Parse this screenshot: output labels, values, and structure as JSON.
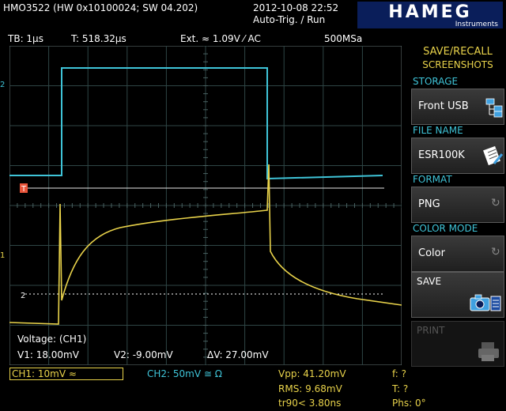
{
  "header": {
    "title": "HMO3522 (HW 0x10100024; SW 04.202)",
    "datetime": "2012-10-08 22:52",
    "trig_mode": "Auto-Trig. / Run",
    "logo_text": "HAMEG",
    "logo_sub": "Instruments"
  },
  "status": {
    "timebase": "TB: 1µs",
    "time": "T: 518.32µs",
    "trigger": "Ext. ≈ 1.09V ⁄ AC",
    "samplerate": "500MSa"
  },
  "screen": {
    "cursor_label": "Voltage: (CH1)",
    "v1": "V1: 18.00mV",
    "v2": "V2: -9.00mV",
    "dv": "ΔV: 27.00mV",
    "marker_ch1": "1",
    "marker_ch2": "2",
    "marker_cursor": "2"
  },
  "menu": {
    "title_line1": "SAVE/RECALL",
    "title_line2": "SCREENSHOTS",
    "storage_label": "STORAGE",
    "storage_value": "Front USB",
    "filename_label": "FILE NAME",
    "filename_value": "ESR100K",
    "format_label": "FORMAT",
    "format_value": "PNG",
    "colormode_label": "COLOR MODE",
    "colormode_value": "Color",
    "save_label": "SAVE",
    "print_label": "PRINT"
  },
  "footer": {
    "ch1": "CH1: 10mV ≈",
    "ch2": "CH2: 50mV ≅ Ω",
    "vpp": "Vpp: 41.20mV",
    "rms": "RMS: 9.68mV",
    "tr": "tr90< 3.80ns",
    "f": "f: ?",
    "t": "T: ?",
    "phs": "Phs: 0°"
  },
  "colors": {
    "ch1": "#e8d24a",
    "ch2": "#3fc4d8",
    "grid": "#3a4a4a",
    "accent": "#e8d24a"
  }
}
